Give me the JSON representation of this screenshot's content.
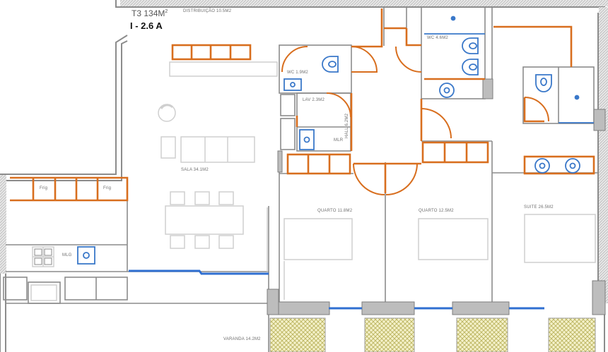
{
  "header": {
    "typology": "T3",
    "area": "134M",
    "area_sup": "2",
    "unit": "I - 2.6 A"
  },
  "rooms": {
    "distribuicao": "DISTRIBUIÇÃO  10.5M2",
    "wc1": "WC  1.9M2",
    "wc2": "WC  4.6M2",
    "lav": "LAV  2.3M2",
    "mlr_small": "MLR",
    "hall": "HALL  6.2M2",
    "sala": "SALA  34.1M2",
    "quarto1": "QUARTO  11.8M2",
    "quarto2": "QUARTO  12.5M2",
    "suite": "SUITE  26.5M2",
    "varanda": "VARANDA  14.2M2",
    "mlg": "MLG",
    "frig1": "Frig",
    "frig2": "Frig"
  },
  "colors": {
    "wall": "#8c8c8c",
    "wall_fill": "#d9d9d9",
    "carpentry": "#d86e1e",
    "sanitary": "#3a78c9",
    "glazing": "#2f6fd1",
    "furniture": "#cfcfcf",
    "planter": "#d8d27a"
  }
}
